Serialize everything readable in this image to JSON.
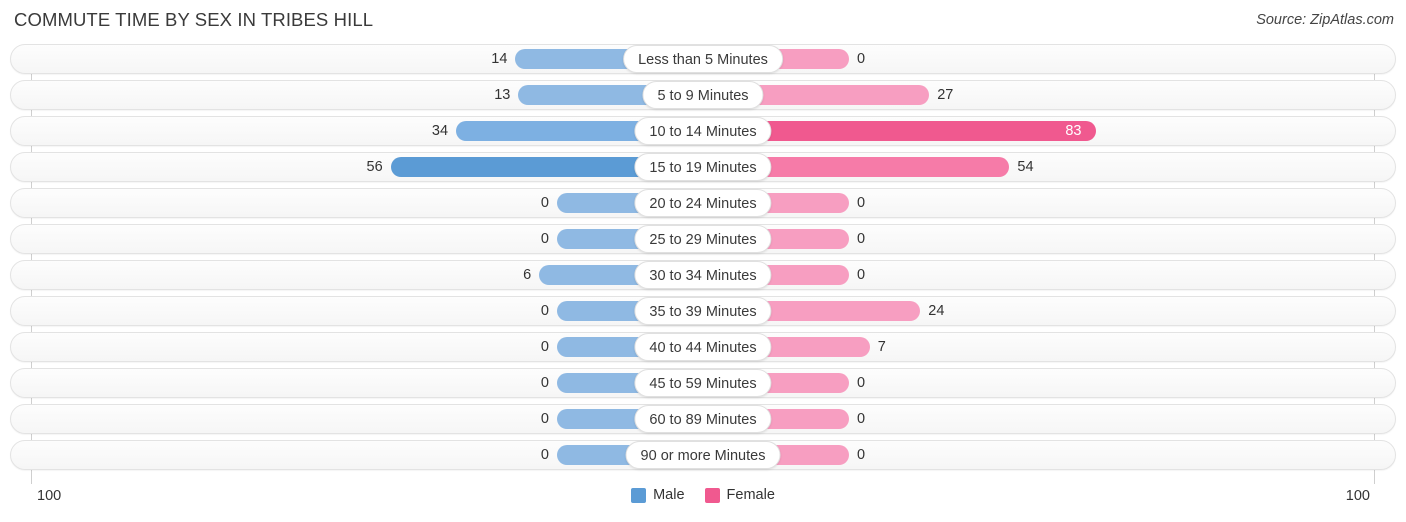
{
  "header": {
    "title": "COMMUTE TIME BY SEX IN TRIBES HILL",
    "source": "Source: ZipAtlas.com"
  },
  "axis": {
    "left_tick": "100",
    "right_tick": "100"
  },
  "legend": {
    "items": [
      {
        "label": "Male",
        "color": "#5b9bd5"
      },
      {
        "label": "Female",
        "color": "#f0598f"
      }
    ]
  },
  "colors": {
    "male_bar": "#85b3e0",
    "male_bar_strong": "#5b9bd5",
    "female_bar": "#f490b8",
    "female_bar_strong": "#f0598f",
    "track_bg": "#f7f7f7",
    "track_border": "#e3e3e3"
  },
  "chart_data": {
    "type": "bar",
    "title": "COMMUTE TIME BY SEX IN TRIBES HILL",
    "orientation": "horizontal-diverging",
    "xlabel": "",
    "ylabel": "",
    "xlim": [
      100,
      100
    ],
    "grid": false,
    "legend_position": "bottom-center",
    "categories": [
      "Less than 5 Minutes",
      "5 to 9 Minutes",
      "10 to 14 Minutes",
      "15 to 19 Minutes",
      "20 to 24 Minutes",
      "25 to 29 Minutes",
      "30 to 34 Minutes",
      "35 to 39 Minutes",
      "40 to 44 Minutes",
      "45 to 59 Minutes",
      "60 to 89 Minutes",
      "90 or more Minutes"
    ],
    "series": [
      {
        "name": "Male",
        "color": "#85b3e0",
        "values": [
          14,
          13,
          34,
          56,
          0,
          0,
          6,
          0,
          0,
          0,
          0,
          0
        ]
      },
      {
        "name": "Female",
        "color": "#f490b8",
        "values": [
          0,
          27,
          83,
          54,
          0,
          0,
          0,
          24,
          7,
          0,
          0,
          0
        ]
      }
    ]
  },
  "rows": [
    {
      "label": "Less than 5 Minutes",
      "male": "14",
      "female": "0",
      "male_value": 14,
      "female_value": 0,
      "male_shade": "light",
      "female_shade": "light",
      "male_inside": false,
      "female_inside": false
    },
    {
      "label": "5 to 9 Minutes",
      "male": "13",
      "female": "27",
      "male_value": 13,
      "female_value": 27,
      "male_shade": "light",
      "female_shade": "light",
      "male_inside": false,
      "female_inside": false
    },
    {
      "label": "10 to 14 Minutes",
      "male": "34",
      "female": "83",
      "male_value": 34,
      "female_value": 83,
      "male_shade": "medium",
      "female_shade": "strong",
      "male_inside": false,
      "female_inside": true
    },
    {
      "label": "15 to 19 Minutes",
      "male": "56",
      "female": "54",
      "male_value": 56,
      "female_value": 54,
      "male_shade": "strong",
      "female_shade": "medium",
      "male_inside": false,
      "female_inside": false
    },
    {
      "label": "20 to 24 Minutes",
      "male": "0",
      "female": "0",
      "male_value": 0,
      "female_value": 0,
      "male_shade": "light",
      "female_shade": "light",
      "male_inside": false,
      "female_inside": false
    },
    {
      "label": "25 to 29 Minutes",
      "male": "0",
      "female": "0",
      "male_value": 0,
      "female_value": 0,
      "male_shade": "light",
      "female_shade": "light",
      "male_inside": false,
      "female_inside": false
    },
    {
      "label": "30 to 34 Minutes",
      "male": "6",
      "female": "0",
      "male_value": 6,
      "female_value": 0,
      "male_shade": "light",
      "female_shade": "light",
      "male_inside": false,
      "female_inside": false
    },
    {
      "label": "35 to 39 Minutes",
      "male": "0",
      "female": "24",
      "male_value": 0,
      "female_value": 24,
      "male_shade": "light",
      "female_shade": "light",
      "male_inside": false,
      "female_inside": false
    },
    {
      "label": "40 to 44 Minutes",
      "male": "0",
      "female": "7",
      "male_value": 0,
      "female_value": 7,
      "male_shade": "light",
      "female_shade": "light",
      "male_inside": false,
      "female_inside": false
    },
    {
      "label": "45 to 59 Minutes",
      "male": "0",
      "female": "0",
      "male_value": 0,
      "female_value": 0,
      "male_shade": "light",
      "female_shade": "light",
      "male_inside": false,
      "female_inside": false
    },
    {
      "label": "60 to 89 Minutes",
      "male": "0",
      "female": "0",
      "male_value": 0,
      "female_value": 0,
      "male_shade": "light",
      "female_shade": "light",
      "male_inside": false,
      "female_inside": false
    },
    {
      "label": "90 or more Minutes",
      "male": "0",
      "female": "0",
      "male_value": 0,
      "female_value": 0,
      "male_shade": "light",
      "female_shade": "light",
      "male_inside": false,
      "female_inside": false
    }
  ]
}
